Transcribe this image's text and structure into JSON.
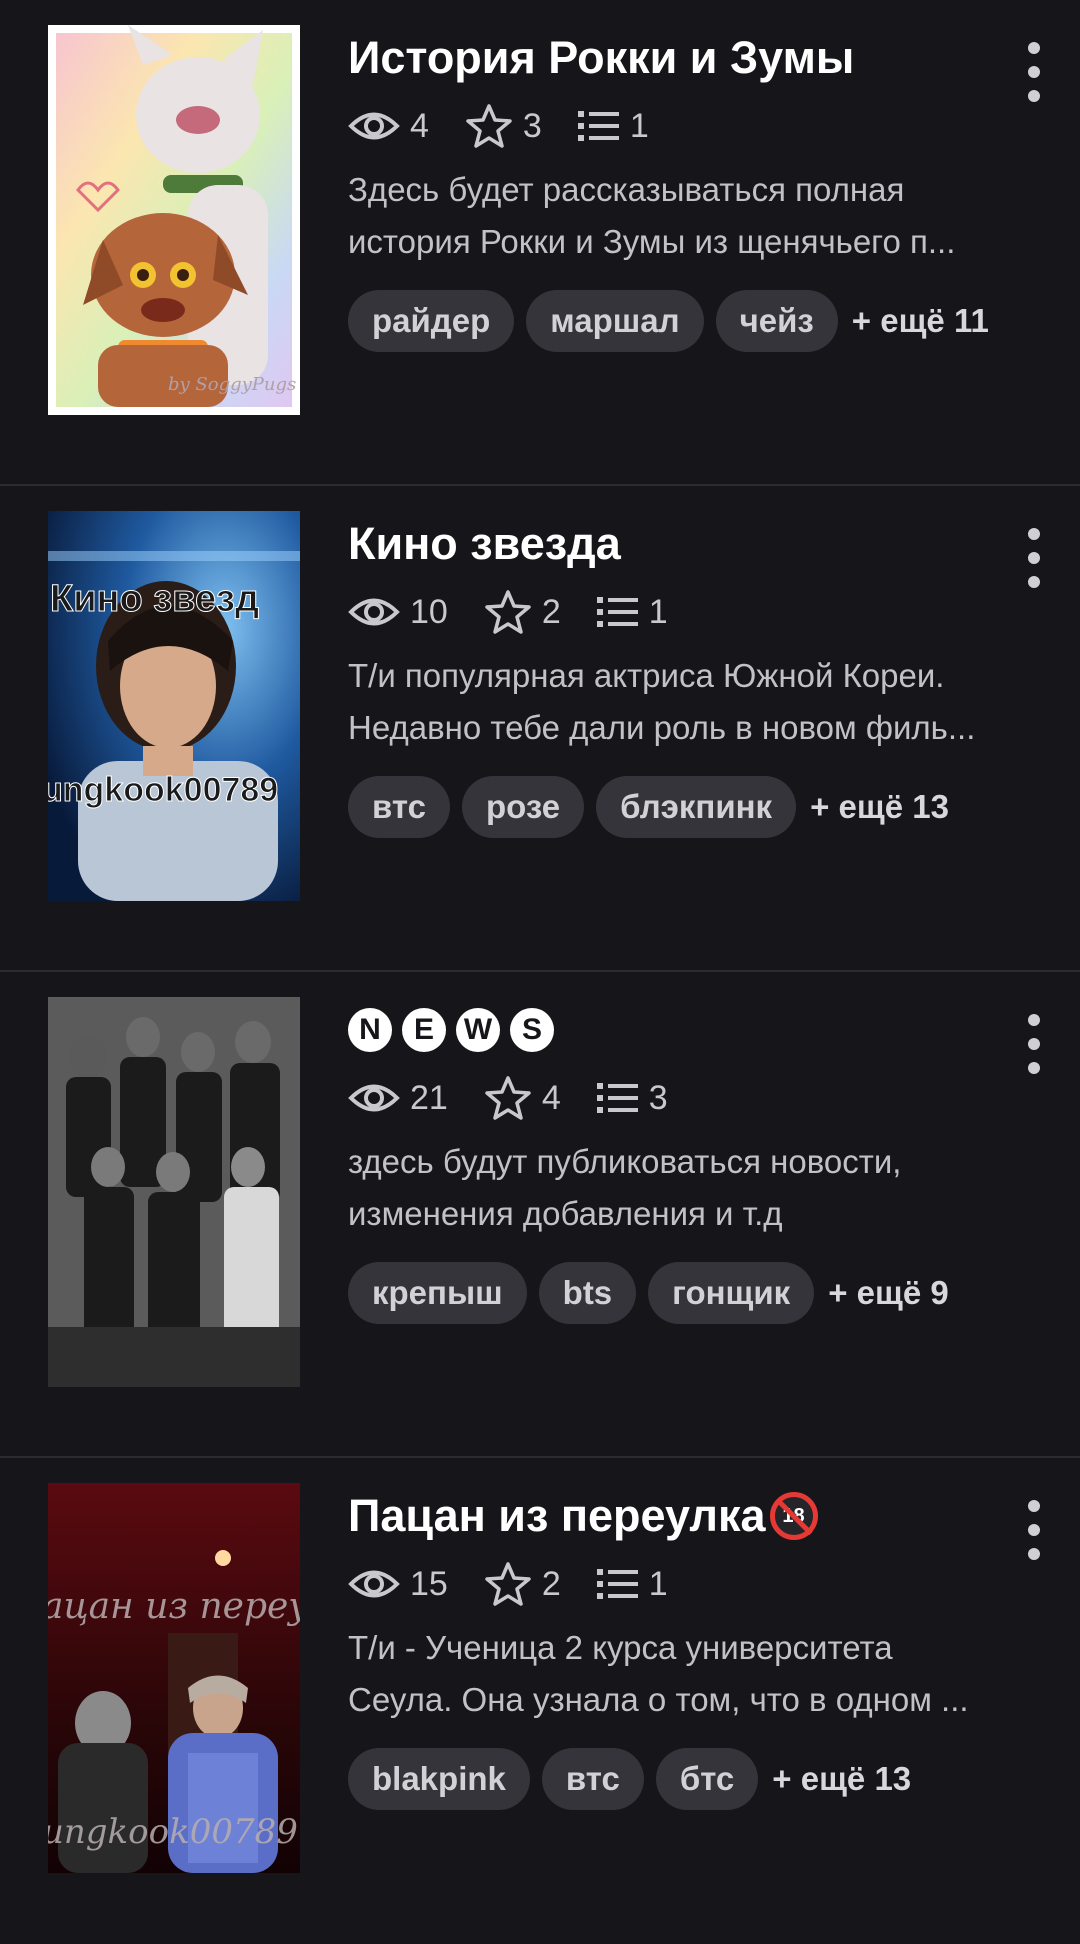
{
  "stories": [
    {
      "title": "История Рокки и Зумы",
      "views": "4",
      "stars": "3",
      "chapters": "1",
      "desc_line1": "Здесь будет рассказываться полная",
      "desc_line2": "история Рокки и Зумы из щенячьего п...",
      "tags": [
        "райдер",
        "маршал",
        "чейз"
      ],
      "more": "+ ещё 11",
      "cover_watermark": "by SoggyPugs"
    },
    {
      "title": "Кино звезда",
      "views": "10",
      "stars": "2",
      "chapters": "1",
      "desc_line1": "Т/и популярная актриса Южной Кореи.",
      "desc_line2": "Недавно тебе дали роль в новом филь...",
      "tags": [
        "втс",
        "розе",
        "блэкпинк"
      ],
      "more": "+ ещё 13",
      "cover_text_top": "Кино звезд",
      "cover_text_bottom": "ungkook00789"
    },
    {
      "title_letters": [
        "N",
        "E",
        "W",
        "S"
      ],
      "views": "21",
      "stars": "4",
      "chapters": "3",
      "desc_line1": "здесь будут публиковаться новости,",
      "desc_line2": "изменения добавления и т.д",
      "tags": [
        "крепыш",
        "bts",
        "гонщик"
      ],
      "more": "+ ещё 9"
    },
    {
      "title": "Пацан из переулка",
      "badge": "18",
      "views": "15",
      "stars": "2",
      "chapters": "1",
      "desc_line1": "Т/и - Ученица 2 курса университета",
      "desc_line2": "Сеула. Она узнала о том, что в одном ...",
      "tags": [
        "blakpink",
        "втс",
        "бтс"
      ],
      "more": "+ ещё 13",
      "cover_text_top": "ацан из переул",
      "cover_text_bottom": "ungkook00789"
    }
  ],
  "colors": {
    "background": "#161519",
    "tag_bg": "#35343a",
    "divider": "#2c2b30",
    "badge_red": "#e53935"
  }
}
